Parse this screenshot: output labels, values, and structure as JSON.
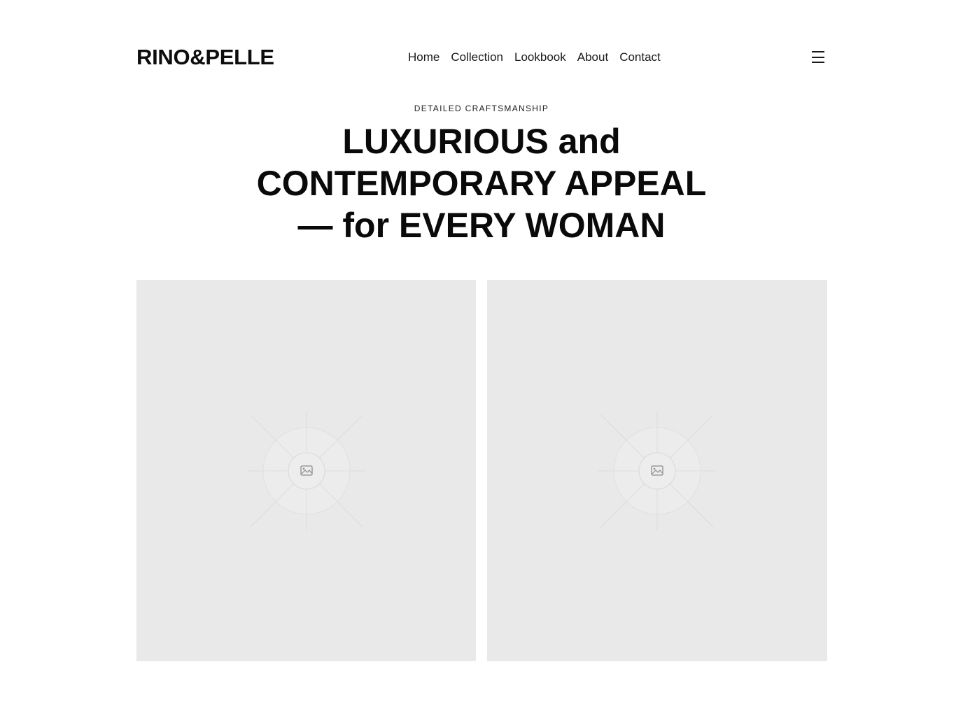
{
  "header": {
    "logo": "RINO&PELLE",
    "nav": [
      "Home",
      "Collection",
      "Lookbook",
      "About",
      "Contact"
    ],
    "menu_icon": "hamburger-menu-icon"
  },
  "hero": {
    "eyebrow": "DETAILED CRAFTSMANSHIP",
    "headline_lines": [
      "LUXURIOUS and",
      "CONTEMPORARY APPEAL",
      "— for EVERY WOMAN"
    ]
  },
  "gallery": {
    "images": [
      {
        "icon": "image-placeholder-icon"
      },
      {
        "icon": "image-placeholder-icon"
      }
    ]
  },
  "colors": {
    "background": "#ffffff",
    "text": "#0a0a0a",
    "placeholder": "#e9e9e9"
  }
}
